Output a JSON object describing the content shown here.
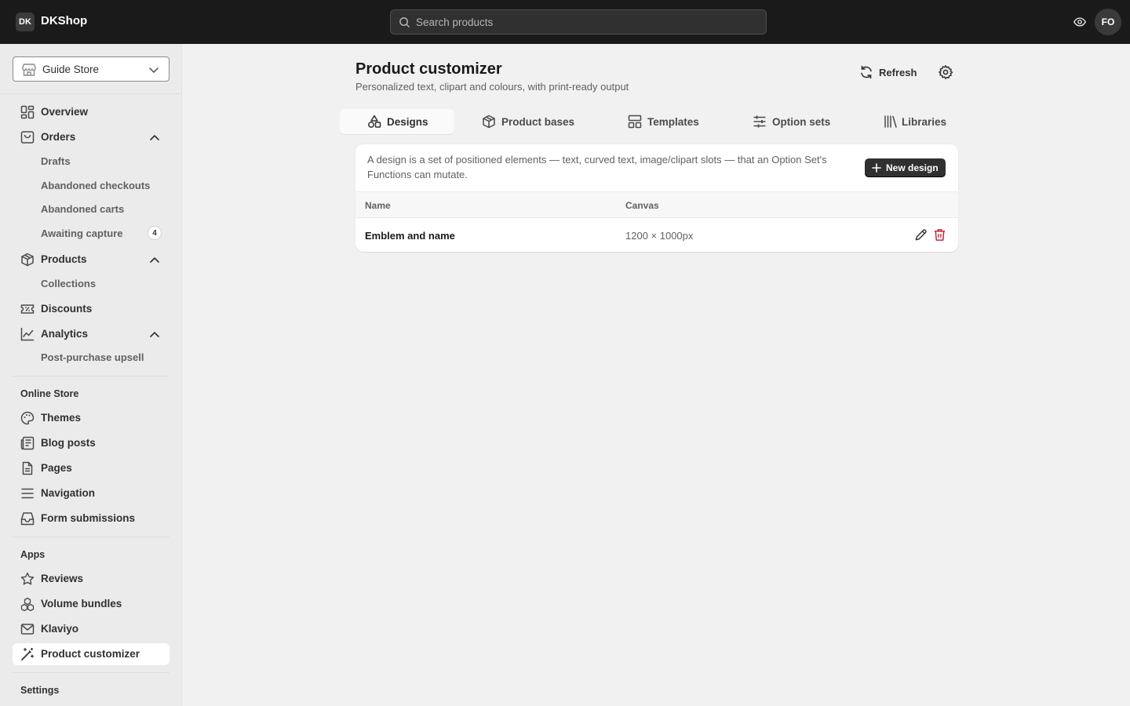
{
  "topbar": {
    "logo": "DK",
    "brand": "DKShop",
    "search_placeholder": "Search products",
    "avatar": "FO"
  },
  "sidebar": {
    "store": "Guide Store",
    "nav": {
      "overview": "Overview",
      "orders": "Orders",
      "drafts": "Drafts",
      "abandoned_checkouts": "Abandoned checkouts",
      "abandoned_carts": "Abandoned carts",
      "awaiting_capture": "Awaiting capture",
      "awaiting_capture_count": "4",
      "products": "Products",
      "collections": "Collections",
      "discounts": "Discounts",
      "analytics": "Analytics",
      "post_purchase_upsell": "Post-purchase upsell"
    },
    "online_store": {
      "heading": "Online Store",
      "themes": "Themes",
      "blog_posts": "Blog posts",
      "pages": "Pages",
      "navigation": "Navigation",
      "form_submissions": "Form submissions"
    },
    "apps": {
      "heading": "Apps",
      "reviews": "Reviews",
      "volume_bundles": "Volume bundles",
      "klaviyo": "Klaviyo",
      "product_customizer": "Product customizer"
    },
    "settings": "Settings"
  },
  "main": {
    "title": "Product customizer",
    "subtitle": "Personalized text, clipart and colours, with print-ready output",
    "refresh": "Refresh",
    "tabs": {
      "designs": "Designs",
      "product_bases": "Product bases",
      "templates": "Templates",
      "option_sets": "Option sets",
      "libraries": "Libraries"
    },
    "card": {
      "description": "A design is a set of positioned elements — text, curved text, image/clipart slots — that an Option Set's Functions can mutate.",
      "new_button": "New design",
      "columns": {
        "name": "Name",
        "canvas": "Canvas"
      },
      "rows": [
        {
          "name": "Emblem and name",
          "canvas": "1200 × 1000px"
        }
      ]
    }
  },
  "colors": {
    "topbar": "#1a1a1a",
    "sidebar": "#ebebeb",
    "background": "#f1f1f1",
    "primary_button": "#303030",
    "danger": "#c5283d"
  }
}
